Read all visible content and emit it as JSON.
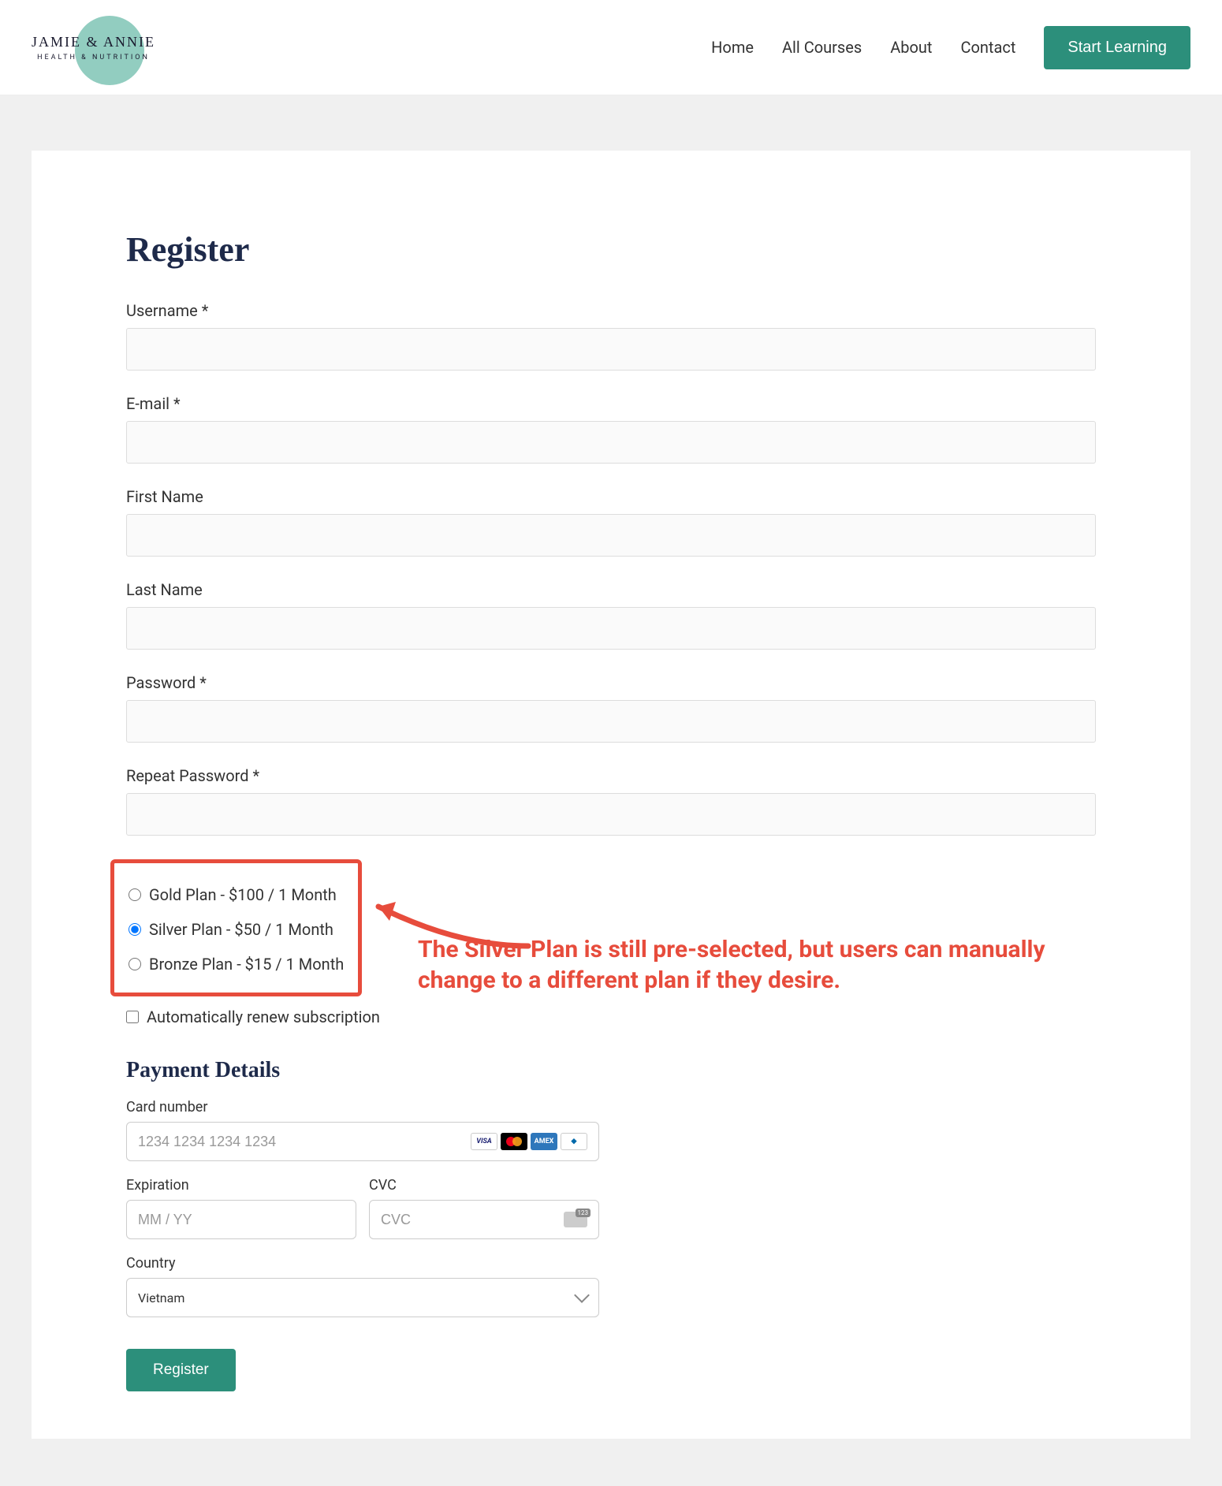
{
  "header": {
    "logo_main": "JAMIE & ANNIE",
    "logo_sub": "HEALTH & NUTRITION",
    "nav": [
      "Home",
      "All Courses",
      "About",
      "Contact"
    ],
    "cta": "Start Learning"
  },
  "form": {
    "title": "Register",
    "fields": {
      "username": "Username *",
      "email": "E-mail *",
      "first_name": "First Name",
      "last_name": "Last Name",
      "password": "Password *",
      "repeat_password": "Repeat Password *"
    },
    "plans": [
      {
        "label": "Gold Plan - $100 / 1 Month",
        "selected": false
      },
      {
        "label": "Silver Plan - $50 / 1 Month",
        "selected": true
      },
      {
        "label": "Bronze Plan - $15 / 1 Month",
        "selected": false
      }
    ],
    "auto_renew": "Automatically renew subscription",
    "annotation": "The Silver Plan is still pre-selected, but users can manually change to a different plan if they desire.",
    "payment": {
      "heading": "Payment Details",
      "card_label": "Card number",
      "card_placeholder": "1234 1234 1234 1234",
      "exp_label": "Expiration",
      "exp_placeholder": "MM / YY",
      "cvc_label": "CVC",
      "cvc_placeholder": "CVC",
      "country_label": "Country",
      "country_value": "Vietnam"
    },
    "submit": "Register"
  }
}
